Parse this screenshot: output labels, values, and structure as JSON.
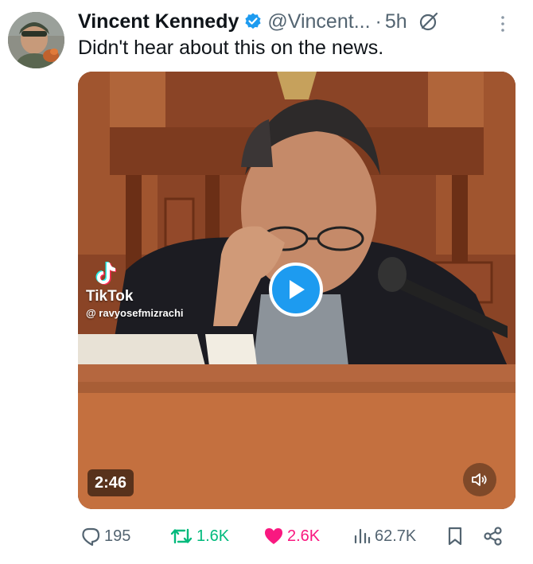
{
  "tweet": {
    "display_name": "Vincent Kennedy",
    "handle": "@Vincent...",
    "separator": "·",
    "time": "5h",
    "text": "Didn't hear about this on the news."
  },
  "media": {
    "watermark_brand": "TikTok",
    "watermark_user": "@ ravyosefmizrachi",
    "duration": "2:46"
  },
  "actions": {
    "replies": "195",
    "reposts": "1.6K",
    "likes": "2.6K",
    "views": "62.7K"
  },
  "icons": {
    "verified": "verified-badge-icon",
    "grok": "grok-icon",
    "more": "more-options-icon",
    "play": "play-icon",
    "volume": "volume-icon",
    "reply": "reply-icon",
    "repost": "repost-icon",
    "like": "heart-icon",
    "views": "views-chart-icon",
    "bookmark": "bookmark-icon",
    "share": "share-icon"
  },
  "colors": {
    "accent": "#1d9bf0",
    "repost": "#00ba7c",
    "like": "#f91880",
    "muted": "#536471",
    "text": "#0f1419"
  }
}
